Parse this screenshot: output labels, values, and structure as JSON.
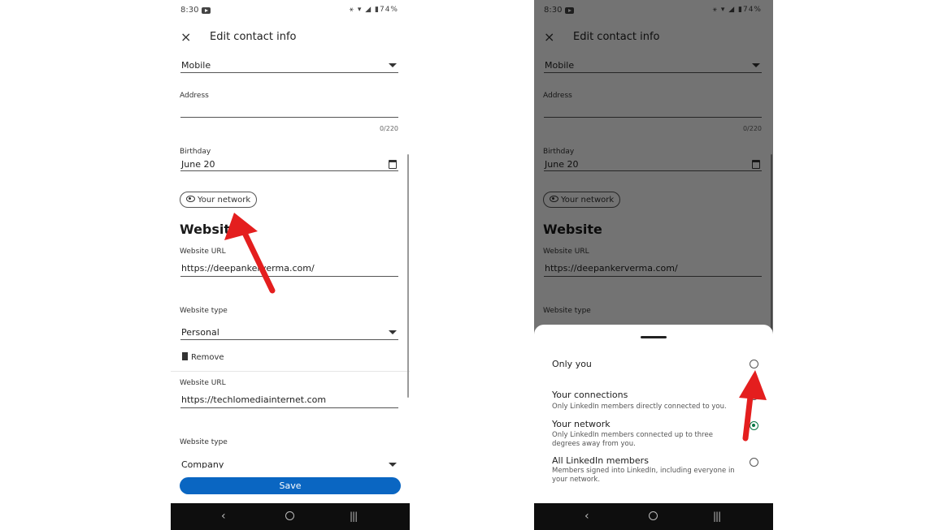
{
  "status_bar": {
    "time": "8:30",
    "battery": "74%"
  },
  "header": {
    "close_icon": "×",
    "title": "Edit contact info"
  },
  "form": {
    "phone_type": "Mobile",
    "address_label": "Address",
    "address_counter": "0/220",
    "birthday_label": "Birthday",
    "birthday_value": "June 20",
    "visibility_pill": "Your network",
    "section_title": "Website",
    "website_url_label": "Website URL",
    "website_url_1": "https://deepankerverma.com/",
    "website_type_label": "Website type",
    "website_type_1": "Personal",
    "remove_label": "Remove",
    "website_url_2": "https://techlomediainternet.com",
    "website_type_2": "Company",
    "save_label": "Save"
  },
  "nav": {
    "back": "‹",
    "recent": "|||"
  },
  "visibility_sheet": {
    "options": [
      {
        "title": "Only you",
        "description": "",
        "selected": false
      },
      {
        "title": "Your connections",
        "description": "Only LinkedIn members directly connected to you.",
        "selected": false
      },
      {
        "title": "Your network",
        "description": "Only LinkedIn members connected up to three degrees away from you.",
        "selected": true
      },
      {
        "title": "All LinkedIn members",
        "description": "Members signed into LinkedIn, including everyone in your network.",
        "selected": false
      }
    ]
  },
  "colors": {
    "save_button": "#0a66c2",
    "selected_radio": "#057642",
    "annotation_arrow": "#e41e1e"
  },
  "icons": [
    "close-icon",
    "chevron-down-icon",
    "calendar-icon",
    "eye-icon",
    "trash-icon",
    "radio-icon",
    "back-icon",
    "home-icon",
    "recents-icon"
  ]
}
